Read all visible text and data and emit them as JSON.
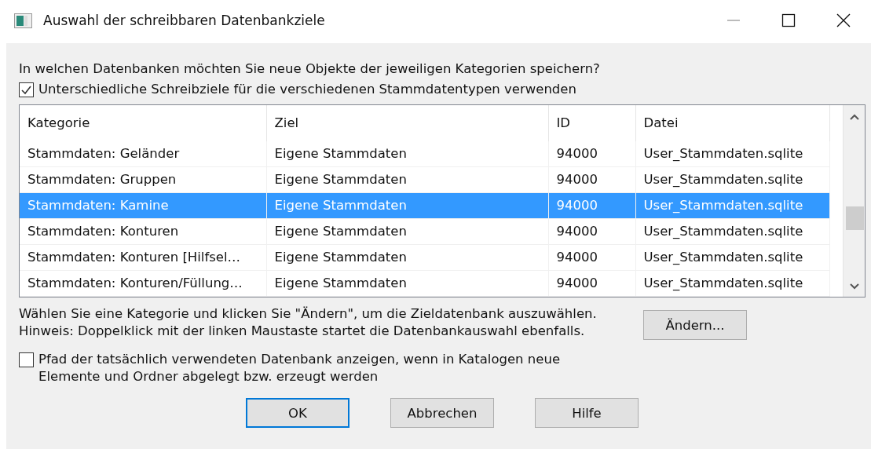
{
  "window": {
    "title": "Auswahl der schreibbaren Datenbankziele"
  },
  "question": "In welchen Datenbanken möchten Sie neue Objekte der jeweiligen Kategorien speichern?",
  "separate_targets": {
    "label": "Unterschiedliche Schreibziele für die verschiedenen Stammdatentypen verwenden",
    "checked": true
  },
  "table": {
    "columns": [
      "Kategorie",
      "Ziel",
      "ID",
      "Datei"
    ],
    "rows": [
      {
        "cells": [
          "Stammdaten: Geländer",
          "Eigene Stammdaten",
          "94000",
          "User_Stammdaten.sqlite"
        ],
        "selected": false
      },
      {
        "cells": [
          "Stammdaten: Gruppen",
          "Eigene Stammdaten",
          "94000",
          "User_Stammdaten.sqlite"
        ],
        "selected": false
      },
      {
        "cells": [
          "Stammdaten: Kamine",
          "Eigene Stammdaten",
          "94000",
          "User_Stammdaten.sqlite"
        ],
        "selected": true
      },
      {
        "cells": [
          "Stammdaten: Konturen",
          "Eigene Stammdaten",
          "94000",
          "User_Stammdaten.sqlite"
        ],
        "selected": false
      },
      {
        "cells": [
          "Stammdaten: Konturen [Hilfsel…",
          "Eigene Stammdaten",
          "94000",
          "User_Stammdaten.sqlite"
        ],
        "selected": false
      },
      {
        "cells": [
          "Stammdaten: Konturen/Füllung…",
          "Eigene Stammdaten",
          "94000",
          "User_Stammdaten.sqlite"
        ],
        "selected": false
      }
    ]
  },
  "hint_lines": [
    "Wählen Sie eine Kategorie und klicken Sie \"Ändern\", um die Zieldatenbank auszuwählen.",
    "Hinweis: Doppelklick mit der linken Maustaste startet die Datenbankauswahl ebenfalls."
  ],
  "change_button": "Ändern...",
  "show_path": {
    "label": "Pfad der tatsächlich verwendeten Datenbank anzeigen, wenn in Katalogen neue Elemente und Ordner abgelegt bzw. erzeugt werden",
    "checked": false
  },
  "buttons": [
    "OK",
    "Abbrechen",
    "Hilfe"
  ]
}
